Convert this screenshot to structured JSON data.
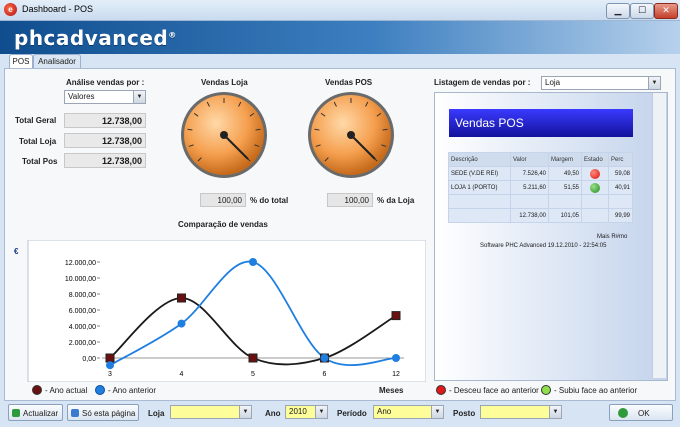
{
  "window": {
    "title": "Dashboard - POS",
    "icon": "app-icon",
    "minimize": "▁",
    "maximize": "☐",
    "close": "✕"
  },
  "brand": {
    "logo_text": "phcadvanced",
    "logo_mark": "®"
  },
  "tabs": [
    {
      "label": "POS",
      "active": true
    },
    {
      "label": "Analisador",
      "active": false
    }
  ],
  "analise": {
    "label": "Análise vendas por :",
    "value": "Valores"
  },
  "totals": [
    {
      "label": "Total Geral",
      "value": "12.738,00"
    },
    {
      "label": "Total Loja",
      "value": "12.738,00"
    },
    {
      "label": "Total Pos",
      "value": "12.738,00"
    }
  ],
  "gauges": {
    "loja": {
      "title": "Vendas Loja",
      "value": "100,00",
      "suffix": "% do total",
      "percent": 100
    },
    "pos": {
      "title": "Vendas POS",
      "value": "100,00",
      "suffix": "% da Loja",
      "percent": 100
    }
  },
  "listagem": {
    "label": "Listagem de vendas por :",
    "value": "Loja"
  },
  "report": {
    "title": "Vendas POS",
    "headers": [
      "Descrição",
      "Valor",
      "Margem",
      "Estado",
      "Perc"
    ],
    "rows": [
      {
        "desc": "SEDE (V.DE REI)",
        "valor": "7.526,40",
        "margem": "49,50",
        "estado": "red",
        "perc": "59,08"
      },
      {
        "desc": "LOJA 1 (PORTO)",
        "valor": "5.211,60",
        "margem": "51,55",
        "estado": "green",
        "perc": "40,91"
      }
    ],
    "totals": {
      "valor": "12.738,00",
      "margem": "101,05",
      "perc": "99,99"
    },
    "footer_more": "Mais R#mo",
    "footer_software": "Software PHC Advanced 19.12.2010 - 22:54:05"
  },
  "chart_data": {
    "type": "line",
    "title": "Comparação de vendas",
    "currency_symbol": "€",
    "xlabel": "Meses",
    "ylabel": "",
    "categories": [
      "3",
      "4",
      "5",
      "6",
      "12"
    ],
    "yticks": [
      "12.000,00",
      "10.000,00",
      "8.000,00",
      "6.000,00",
      "4.000,00",
      "2.000,00",
      "0,00"
    ],
    "ylim": [
      -1000,
      12500
    ],
    "series": [
      {
        "name": "Ano actual",
        "values": [
          0,
          7500,
          0,
          0,
          5300
        ],
        "color": "#1a1a1a",
        "marker": "#6b1010"
      },
      {
        "name": "Ano anterior",
        "values": [
          -900,
          4300,
          12000,
          0,
          0
        ],
        "color": "#1f7fe0",
        "marker": "#1f7fe0"
      }
    ],
    "grid": false
  },
  "legend_status": {
    "down": "Desceu face ao anterior",
    "up": "Subiu face ao anterior"
  },
  "bottom": {
    "atualizar": "Actualizar",
    "so_pagina": "Só esta página",
    "loja_label": "Loja",
    "loja_value": "",
    "ano_label": "Ano",
    "ano_value": "2010",
    "periodo_label": "Período",
    "periodo_value": "Ano",
    "posto_label": "Posto",
    "posto_value": "",
    "ok": "OK"
  },
  "colors": {
    "accent": "#1f4e8e",
    "report_title_bg": "#2020d0",
    "input_yellow": "#fdfd9a"
  }
}
